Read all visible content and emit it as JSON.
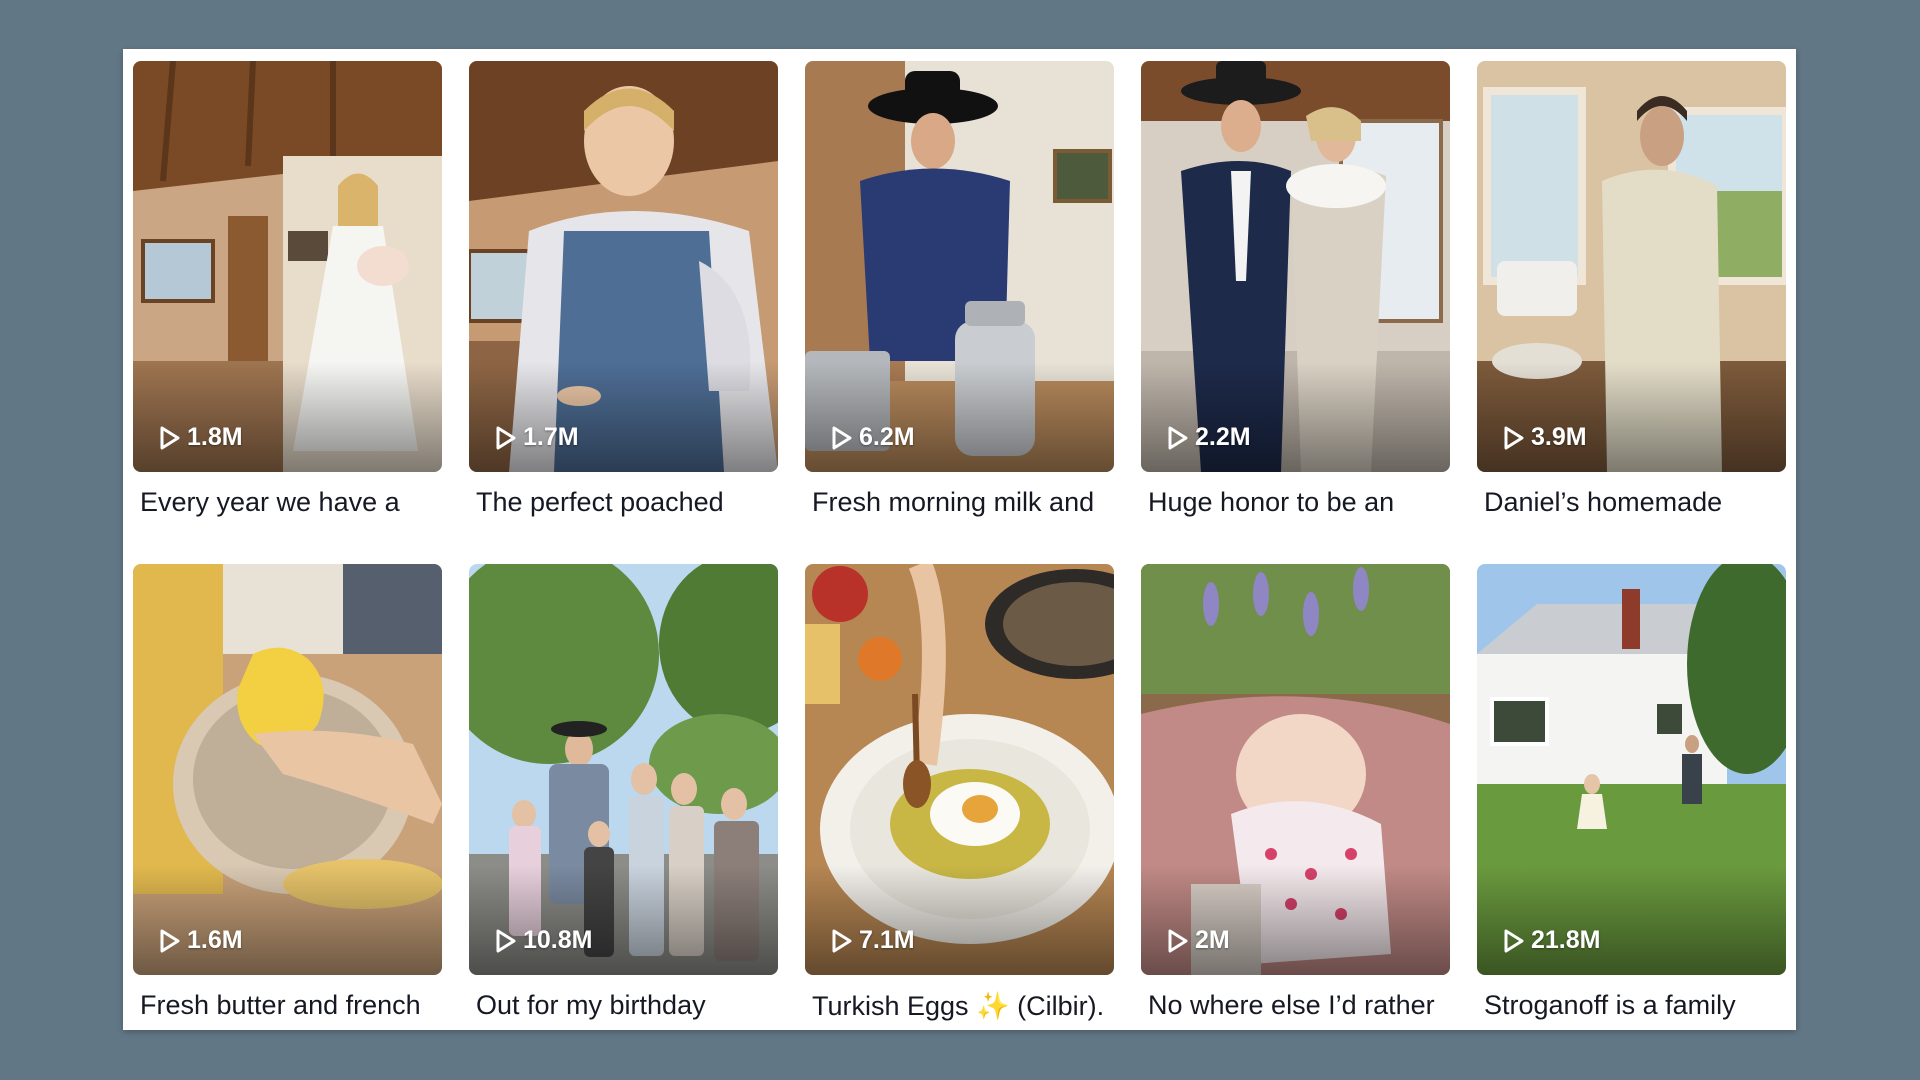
{
  "videos": [
    {
      "views": "1.8M",
      "caption": "Every year we have a",
      "scene": "woman-holding-baby-in-kitchen"
    },
    {
      "views": "1.7M",
      "caption": "The perfect poached",
      "scene": "woman-in-apron-cooking"
    },
    {
      "views": "6.2M",
      "caption": "Fresh morning milk and",
      "scene": "cowboy-with-milk-cans"
    },
    {
      "views": "2.2M",
      "caption": "Huge honor to be an",
      "scene": "couple-in-formal-wear"
    },
    {
      "views": "3.9M",
      "caption": "Daniel’s homemade",
      "scene": "man-cooking-by-window"
    },
    {
      "views": "1.6M",
      "caption": "Fresh butter and french",
      "scene": "butter-in-stand-mixer-bowl"
    },
    {
      "views": "10.8M",
      "caption": "Out for my birthday",
      "scene": "large-family-outdoors"
    },
    {
      "views": "7.1M",
      "caption": "Turkish Eggs ✨ (Cilbir).",
      "scene": "turkish-eggs-plate"
    },
    {
      "views": "2M",
      "caption": "No where else I’d rather",
      "scene": "sleeping-baby-on-porch"
    },
    {
      "views": "21.8M",
      "caption": "Stroganoff is a family",
      "scene": "farmhouse-lawn-with-child"
    }
  ]
}
